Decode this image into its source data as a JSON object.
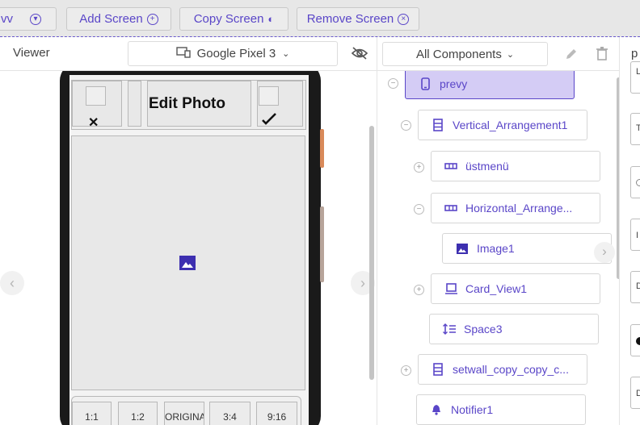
{
  "toolbar": {
    "screen_selector": "vv",
    "add_screen": "Add Screen",
    "copy_screen": "Copy Screen",
    "remove_screen": "Remove Screen"
  },
  "viewer": {
    "label": "Viewer",
    "device": "Google Pixel 3"
  },
  "phone_screen": {
    "title": "Edit Photo",
    "ratios": [
      "1:1",
      "1:2",
      "ORIGINA",
      "3:4",
      "9:16"
    ]
  },
  "components": {
    "filter": "All Components",
    "tree": [
      {
        "label": "prevy",
        "icon": "phone-icon",
        "selected": true
      },
      {
        "label": "Vertical_Arrangement1",
        "icon": "vertical-arrangement-icon"
      },
      {
        "label": "üstmenü",
        "icon": "horizontal-arrangement-icon"
      },
      {
        "label": "Horizontal_Arrange...",
        "icon": "horizontal-arrangement-icon"
      },
      {
        "label": "Image1",
        "icon": "image-icon"
      },
      {
        "label": "Card_View1",
        "icon": "card-view-icon"
      },
      {
        "label": "Space3",
        "icon": "space-icon"
      },
      {
        "label": "setwall_copy_copy_c...",
        "icon": "vertical-arrangement-icon"
      },
      {
        "label": "Notifier1",
        "icon": "notifier-icon"
      }
    ]
  },
  "properties": {
    "heading": "p",
    "box_labels": [
      "L",
      "T",
      "",
      "I",
      "D",
      "",
      "D"
    ]
  },
  "colors": {
    "accent": "#5a46c8",
    "selected_bg": "#d4ccf5",
    "toolbar_bg": "#e7e7e7"
  }
}
